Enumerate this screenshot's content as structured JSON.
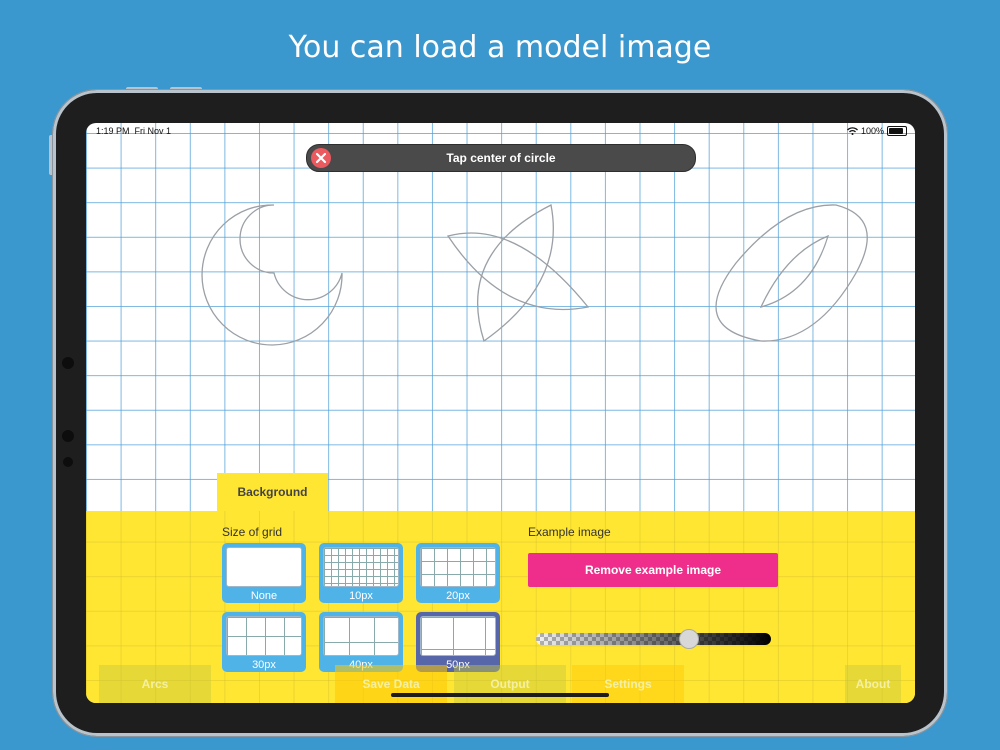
{
  "headline": "You can load a model image",
  "status": {
    "time": "1:19 PM",
    "date": "Fri Nov 1",
    "battery": "100%"
  },
  "toast": {
    "message": "Tap center of circle"
  },
  "panel": {
    "tab_label": "Background",
    "grid_size_label": "Size of grid",
    "grid_options": [
      "None",
      "10px",
      "20px",
      "30px",
      "40px",
      "50px"
    ],
    "selected_grid": "50px",
    "example_image_label": "Example image",
    "remove_button": "Remove example image",
    "opacity_level": 0.65
  },
  "bottom_tabs": [
    "Arcs",
    "Save Data",
    "Output",
    "Settings",
    "About"
  ],
  "colors": {
    "background": "#3a98cf",
    "panel": "#ffe633",
    "accent_pink": "#ef2e8b",
    "tile": "#4fb3e8",
    "tile_selected": "#5765a9"
  }
}
